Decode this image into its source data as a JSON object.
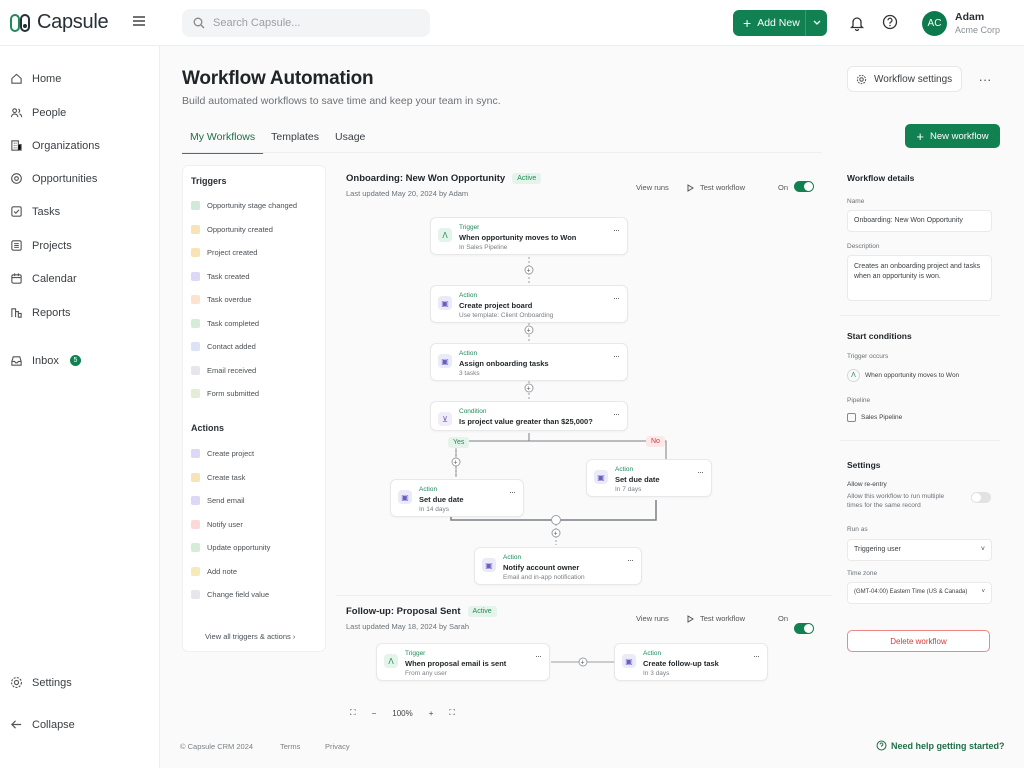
{
  "app": {
    "name": "Capsule"
  },
  "search": {
    "placeholder": "Search Capsule..."
  },
  "topbar": {
    "add_new": "Add New"
  },
  "user": {
    "initials": "AC",
    "name": "Adam",
    "org": "Acme Corp"
  },
  "nav": [
    {
      "label": "Home",
      "icon": "home-icon"
    },
    {
      "label": "People",
      "icon": "people-icon"
    },
    {
      "label": "Organizations",
      "icon": "building-icon"
    },
    {
      "label": "Opportunities",
      "icon": "target-icon"
    },
    {
      "label": "Tasks",
      "icon": "checkbox-icon"
    },
    {
      "label": "Projects",
      "icon": "projects-icon"
    },
    {
      "label": "Calendar",
      "icon": "calendar-icon"
    },
    {
      "label": "Reports",
      "icon": "reports-icon"
    },
    {
      "label": "Inbox",
      "icon": "inbox-icon",
      "badge": "5"
    }
  ],
  "nav_bottom": {
    "settings": "Settings",
    "collapse": "Collapse"
  },
  "page": {
    "title": "Workflow Automation",
    "subtitle": "Build automated workflows to save time and keep your team in sync.",
    "settings_btn": "Workflow settings",
    "more": "···",
    "new_workflow": "New workflow"
  },
  "tabs": [
    "My Workflows",
    "Templates",
    "Usage"
  ],
  "left": {
    "triggers_title": "Triggers",
    "triggers": [
      "Opportunity stage changed",
      "Opportunity created",
      "Project created",
      "Task created",
      "Task overdue",
      "Task completed",
      "Contact added",
      "Email received",
      "Form submitted"
    ],
    "actions_title": "Actions",
    "actions": [
      "Create project",
      "Create task",
      "Send email",
      "Notify user",
      "Update opportunity",
      "Add note",
      "Change field value"
    ],
    "view_all": "View all triggers & actions"
  },
  "wf1": {
    "name": "Onboarding: New Won Opportunity",
    "status": "Active",
    "updated": "Last updated May 20, 2024 by Adam",
    "view_runs": "View runs",
    "test": "Test workflow",
    "on": "On",
    "nodes": [
      {
        "type": "Trigger",
        "title": "When opportunity moves to Won",
        "sub": "In Sales Pipeline"
      },
      {
        "type": "Action",
        "title": "Create project board",
        "sub": "Use template: Client Onboarding"
      },
      {
        "type": "Action",
        "title": "Assign onboarding tasks",
        "sub": "3 tasks"
      },
      {
        "type": "Condition",
        "title": "Is project value greater than $25,000?",
        "sub": ""
      },
      {
        "type": "Action",
        "title": "Set due date",
        "sub": "In 14 days"
      },
      {
        "type": "Action",
        "title": "Set due date",
        "sub": "In 7 days"
      },
      {
        "type": "Action",
        "title": "Notify account owner",
        "sub": "Email and in-app notification"
      }
    ],
    "yes": "Yes",
    "no": "No"
  },
  "wf2": {
    "name": "Follow-up: Proposal Sent",
    "status": "Active",
    "updated": "Last updated May 18, 2024 by Sarah",
    "view_runs": "View runs",
    "test": "Test workflow",
    "on": "On",
    "nodes": [
      {
        "type": "Trigger",
        "title": "When proposal email is sent",
        "sub": "From any user"
      },
      {
        "type": "Action",
        "title": "Create follow-up task",
        "sub": "In 3 days"
      }
    ]
  },
  "zoom": {
    "level": "100%"
  },
  "details": {
    "title": "Workflow details",
    "name_label": "Name",
    "name_value": "Onboarding: New Won Opportunity",
    "desc_label": "Description",
    "desc_value": "Creates an onboarding project and tasks when an opportunity is won.",
    "start_title": "Start conditions",
    "trigger_label": "Trigger occurs",
    "trigger_value": "When opportunity moves to Won",
    "pipeline_label": "Pipeline",
    "pipeline_value": "Sales Pipeline",
    "settings_title": "Settings",
    "reentry_label": "Allow re-entry",
    "reentry_desc": "Allow this workflow to run multiple times for the same record",
    "run_as_label": "Run as",
    "run_as_value": "Triggering user",
    "tz_label": "Time zone",
    "tz_value": "(GMT-04:00) Eastern Time (US & Canada)",
    "delete": "Delete workflow"
  },
  "footer": {
    "copyright": "© Capsule CRM 2024",
    "terms": "Terms",
    "privacy": "Privacy",
    "help": "Need help getting started?"
  },
  "colors": {
    "brand": "#128152",
    "trigger": "#e5f4ea",
    "action": "#ebeaf9",
    "condition": "#f1ecf8"
  }
}
